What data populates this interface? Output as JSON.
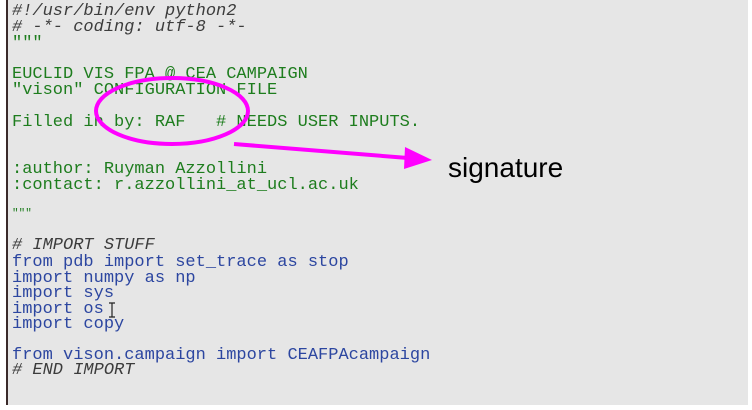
{
  "editor": {
    "lines": [
      {
        "text": "#!/usr/bin/env python2",
        "kind": "comment"
      },
      {
        "text": "# -*- coding: utf-8 -*-",
        "kind": "comment"
      },
      {
        "text": "\"\"\"",
        "kind": "string"
      },
      {
        "text": "EUCLID VIS FPA @ CEA CAMPAIGN",
        "kind": "string"
      },
      {
        "text": "\"vison\" CONFIGURATION FILE",
        "kind": "string"
      },
      {
        "text": "Filled in by: RAF   # NEEDS USER INPUTS.",
        "kind": "string"
      },
      {
        "text": ":author: Ruyman Azzollini",
        "kind": "string"
      },
      {
        "text": ":contact: r.azzollini_at_ucl.ac.uk",
        "kind": "string"
      },
      {
        "text": "\"\"\"",
        "kind": "string"
      },
      {
        "text": "# IMPORT STUFF",
        "kind": "comment"
      },
      {
        "text": "from pdb import set_trace as stop",
        "kind": "code"
      },
      {
        "text": "import numpy as np",
        "kind": "code"
      },
      {
        "text": "import sys",
        "kind": "code"
      },
      {
        "text": "import os",
        "kind": "code"
      },
      {
        "text": "import copy",
        "kind": "code"
      },
      {
        "text": "from vison.campaign import CEAFPAcampaign",
        "kind": "code"
      },
      {
        "text": "# END IMPORT",
        "kind": "comment"
      }
    ]
  },
  "annotation": {
    "label": "signature",
    "color": "#ff00ff"
  },
  "colors": {
    "comment": "#3c3c3c",
    "string": "#1e7d1e",
    "code": "#2c46a0",
    "background": "#e6e6e6"
  }
}
